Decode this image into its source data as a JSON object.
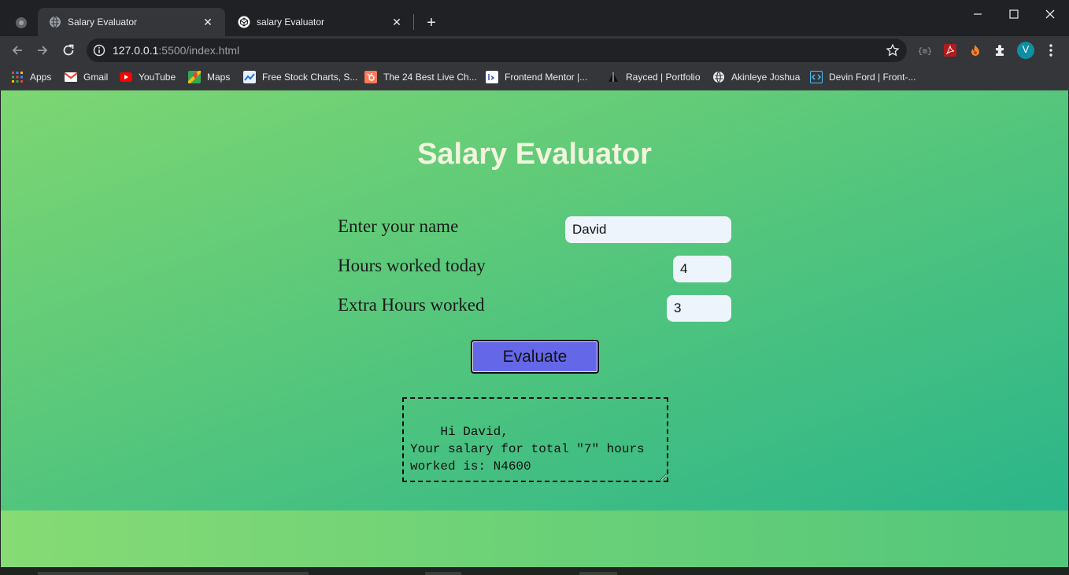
{
  "browser": {
    "tabs": [
      {
        "title": "Salary Evaluator",
        "active": true
      },
      {
        "title": "salary Evaluator",
        "active": false
      }
    ],
    "url_host": "127.0.0.1",
    "url_rest": ":5500/index.html",
    "profile_initial": "V",
    "bookmarks": [
      {
        "label": "Apps",
        "icon": "apps-grid-icon"
      },
      {
        "label": "Gmail",
        "icon": "gmail-icon"
      },
      {
        "label": "YouTube",
        "icon": "youtube-icon"
      },
      {
        "label": "Maps",
        "icon": "maps-icon"
      },
      {
        "label": "Free Stock Charts, S...",
        "icon": "stock-charts-icon"
      },
      {
        "label": "The 24 Best Live Ch...",
        "icon": "hubspot-icon"
      },
      {
        "label": "Frontend Mentor |...",
        "icon": "frontend-mentor-icon"
      },
      {
        "label": "Rayced | Portfolio",
        "icon": "portfolio-icon"
      },
      {
        "label": "Akinleye Joshua",
        "icon": "globe-icon"
      },
      {
        "label": "Devin Ford | Front-...",
        "icon": "code-icon"
      }
    ]
  },
  "app": {
    "title": "Salary Evaluator",
    "name_label": "Enter your name",
    "name_value": "David",
    "hours_label": "Hours worked today",
    "hours_value": "4",
    "extra_label": "Extra Hours worked",
    "extra_value": "3",
    "evaluate_label": "Evaluate",
    "result_text": "Hi David,\nYour salary for total \"7\" hours worked is: N4600"
  },
  "colors": {
    "page_gradient_start": "#7dd672",
    "page_gradient_end": "#2bb58a",
    "heading": "#f3f4dd",
    "button": "#6467e8",
    "input_bg": "#eef4fb"
  }
}
